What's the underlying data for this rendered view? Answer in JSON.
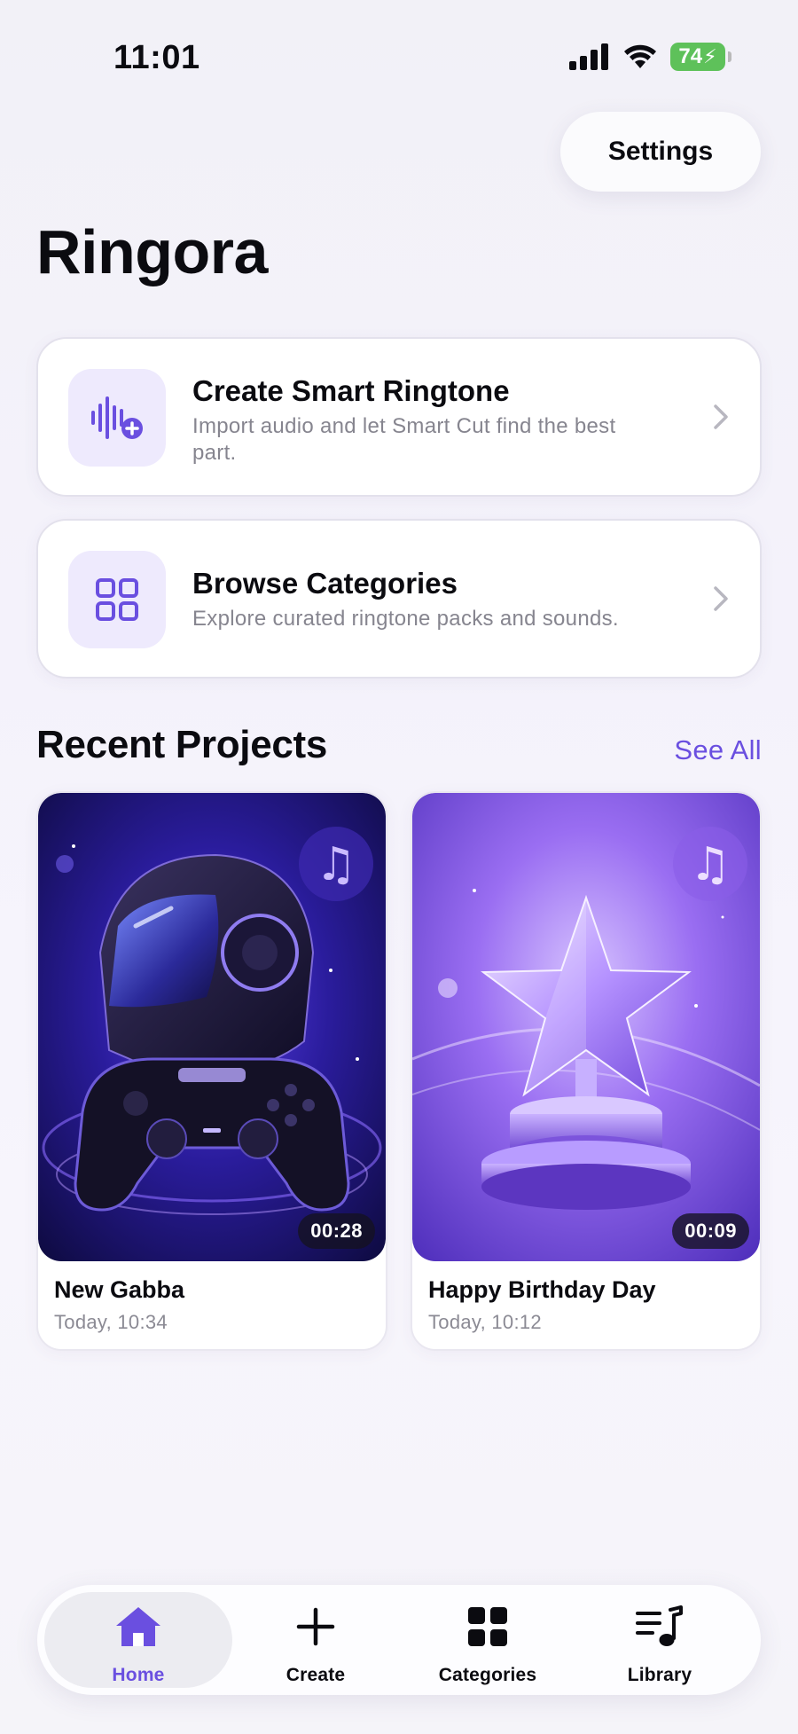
{
  "status_bar": {
    "time": "11:01",
    "battery_percent": "74"
  },
  "header": {
    "settings_label": "Settings",
    "app_title": "Ringora"
  },
  "actions": [
    {
      "title": "Create Smart Ringtone",
      "subtitle": "Import audio and let Smart Cut find the best part.",
      "icon": "waveform-plus-icon"
    },
    {
      "title": "Browse Categories",
      "subtitle": "Explore curated ringtone packs and sounds.",
      "icon": "grid-icon"
    }
  ],
  "recent": {
    "title": "Recent Projects",
    "see_all_label": "See All",
    "projects": [
      {
        "name": "New Gabba",
        "date": "Today, 10:34",
        "duration": "00:28",
        "artwork": "helmet-gamepad-art"
      },
      {
        "name": "Happy Birthday Day",
        "date": "Today, 10:12",
        "duration": "00:09",
        "artwork": "crystal-star-trophy-art"
      }
    ]
  },
  "tabbar": {
    "tabs": [
      {
        "label": "Home",
        "icon": "home-icon",
        "active": true
      },
      {
        "label": "Create",
        "icon": "plus-icon",
        "active": false
      },
      {
        "label": "Categories",
        "icon": "grid-icon",
        "active": false
      },
      {
        "label": "Library",
        "icon": "music-list-icon",
        "active": false
      }
    ]
  },
  "colors": {
    "accent": "#6a4fe0",
    "icon_tile": "#eeeafd",
    "battery": "#5ec15a"
  }
}
